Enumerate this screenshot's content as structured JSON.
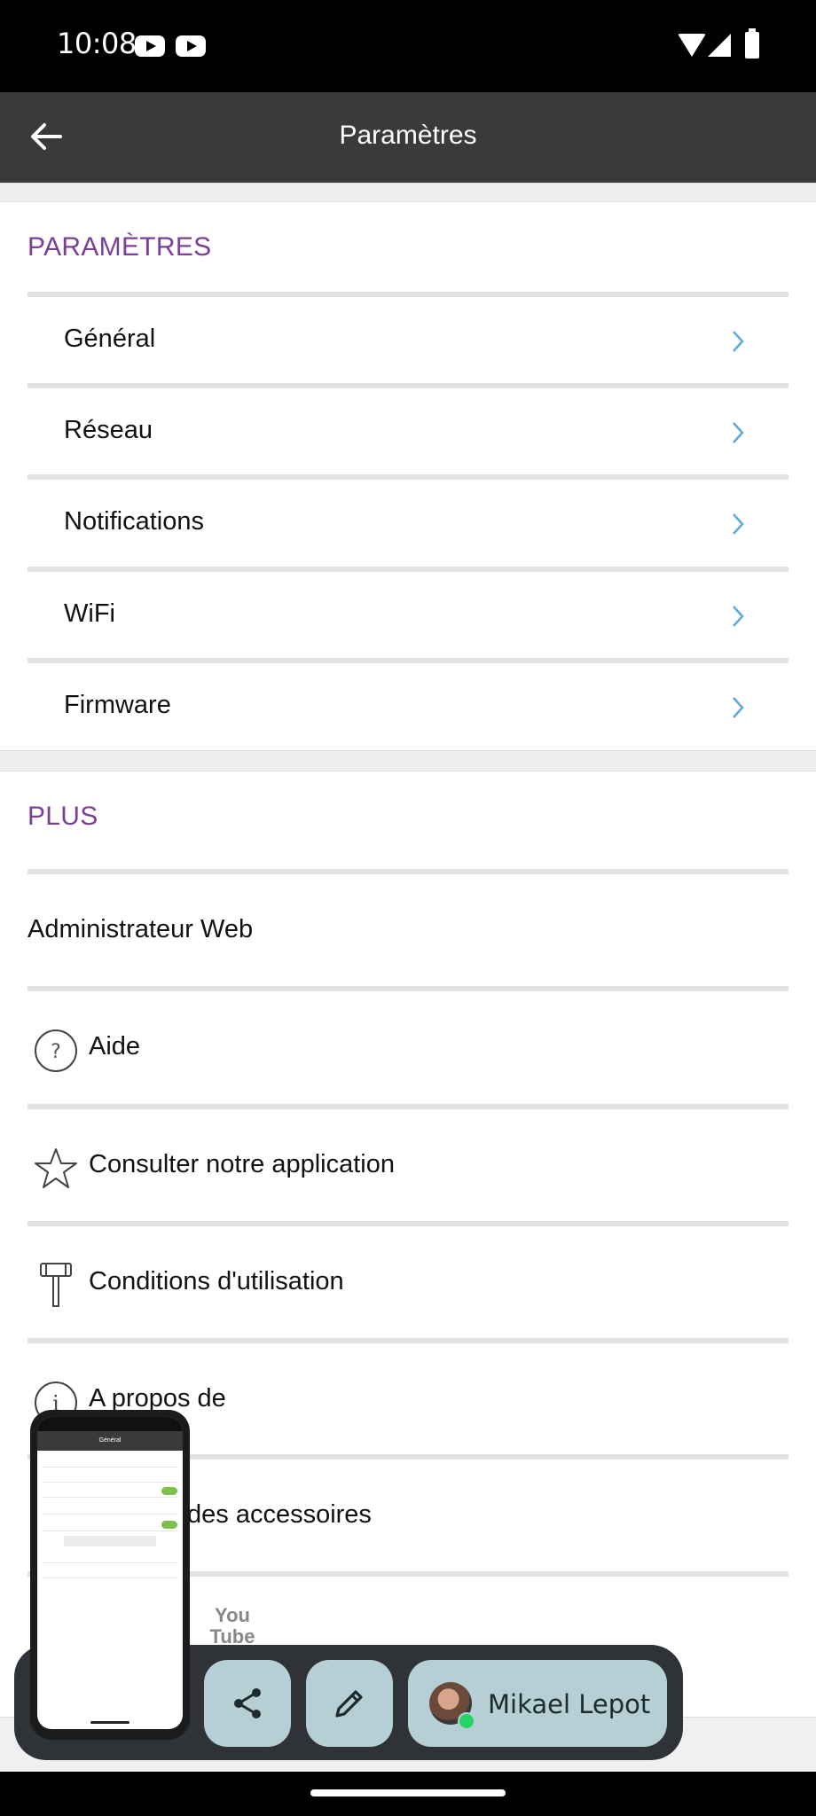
{
  "status_bar": {
    "time": "10:08",
    "notification_icons": [
      "youtube-icon",
      "youtube-icon"
    ],
    "system_icons": [
      "wifi-icon",
      "signal-icon",
      "battery-icon"
    ]
  },
  "app_bar": {
    "title": "Paramètres",
    "back_icon": "arrow-left-icon"
  },
  "parametres": {
    "header": "PARAMÈTRES",
    "items": [
      {
        "label": "Général"
      },
      {
        "label": "Réseau"
      },
      {
        "label": "Notifications"
      },
      {
        "label": "WiFi"
      },
      {
        "label": "Firmware"
      }
    ],
    "chevron_color": "#5aa9dc"
  },
  "plus": {
    "header": "PLUS",
    "items": [
      {
        "label": "Administrateur Web",
        "icon": ""
      },
      {
        "label": "Aide",
        "icon": "help-circle-icon"
      },
      {
        "label": "Consulter notre application",
        "icon": "star-icon"
      },
      {
        "label": "Conditions d'utilisation",
        "icon": "gavel-icon"
      },
      {
        "label": "A propos de",
        "icon": "info-icon"
      },
      {
        "label": "des accessoires",
        "icon": ""
      }
    ]
  },
  "floating_toolbar": {
    "share_icon": "share-icon",
    "edit_icon": "pencil-icon",
    "user_name": "Mikael Lepot",
    "youtube_logo": "You Tube"
  },
  "thumbnail": {
    "title": "Général"
  },
  "colors": {
    "accent": "#7b3f98",
    "app_bar": "#3a3a3a",
    "chip": "#b5cfd4"
  }
}
